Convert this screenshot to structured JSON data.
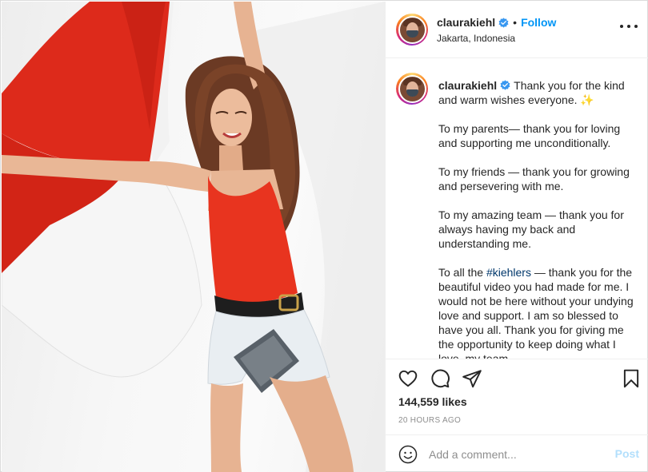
{
  "post": {
    "photo_alt": "",
    "header": {
      "username": "claurakiehl",
      "separator": "•",
      "follow_label": "Follow",
      "location": "Jakarta, Indonesia"
    },
    "caption": {
      "username": "claurakiehl",
      "line1": "Thank you for the kind and warm wishes everyone.",
      "sparkle": "✨",
      "p2": "To my parents— thank you for loving and supporting me unconditionally.",
      "p3": "To my friends — thank you for growing and persevering with me.",
      "p4": "To my amazing team — thank you for always having my back and understanding me.",
      "p5_prefix": "To all the ",
      "p5_hashtag": "#kiehlers",
      "p5_rest": " — thank you for the beautiful video you had made for me. I would not be here without your undying love and support. I am so blessed to have you all. Thank you for giving me the opportunity to keep doing what I love, my team"
    },
    "likes": "144,559 likes",
    "timestamp": "20 HOURS AGO",
    "comment": {
      "placeholder": "Add a comment...",
      "post_label": "Post"
    },
    "icons": {
      "like": "heart-icon",
      "comment": "comment-icon",
      "share": "paper-plane-icon",
      "save": "bookmark-icon",
      "emoji": "smiley-icon",
      "verified": "verified-badge-icon",
      "more": "more-options-icon"
    },
    "colors": {
      "follow": "#0095f6",
      "verified": "#3897f0",
      "hashtag": "#00376b",
      "post_disabled": "#b2dffc",
      "flag_red": "#dd2a1b",
      "top_red": "#e8341f"
    }
  }
}
